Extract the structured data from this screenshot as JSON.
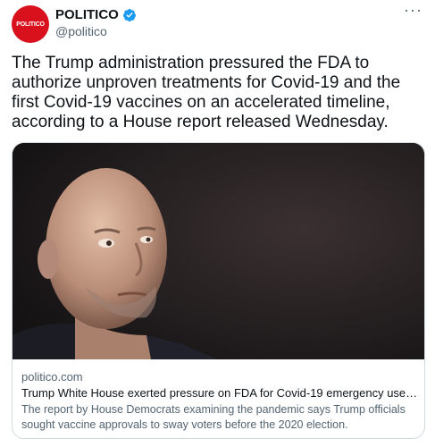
{
  "account": {
    "display_name": "POLITICO",
    "handle": "@politico",
    "avatar_text": "POLITICO",
    "verified": true
  },
  "menu": {
    "more_icon": "more-horizontal-icon"
  },
  "tweet": {
    "text": "The Trump administration pressured the FDA to authorize unproven treatments for Covid-19 and the first Covid-19 vaccines on an accelerated timeline, according to a House report released Wednesday."
  },
  "link_card": {
    "domain": "politico.com",
    "title": "Trump White House exerted pressure on FDA for Covid-19 emergency use auth...",
    "description": "The report by House Democrats examining the pandemic says Trump officials sought vaccine approvals to sway voters before the 2020 election."
  },
  "colors": {
    "brand_red": "#d8111c",
    "verified_blue": "#1d9bf0",
    "text_primary": "#0f1419",
    "text_secondary": "#536471",
    "border": "#cfd9de"
  }
}
